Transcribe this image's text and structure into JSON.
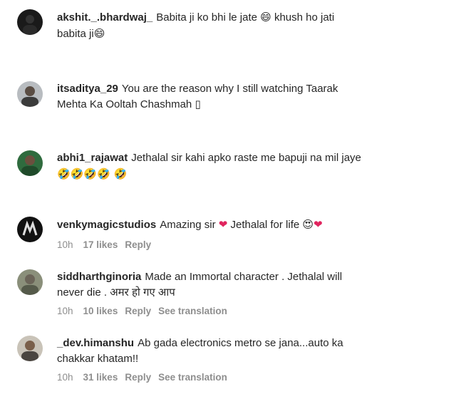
{
  "comments": [
    {
      "username": "akshit._.bhardwaj_",
      "line1": "Babita ji ko bhi le jate ",
      "emoji1": "😄",
      "line1b": " khush ho jati",
      "line2": "babita ji",
      "emoji2": "😄"
    },
    {
      "username": "itsaditya_29",
      "line1": "You are the reason why I still watching Taarak",
      "line2": "Mehta Ka Ooltah Chashmah ▯"
    },
    {
      "username": "abhi1_rajawat",
      "line1": "Jethalal sir kahi apko raste me bapuji na mil jaye",
      "emojis": "🤣🤣🤣🤣 🤣"
    },
    {
      "username": "venkymagicstudios",
      "line1": "Amazing sir ",
      "heart1": "❤",
      "line1b": " Jethalal for life ",
      "emoji_end": "😍",
      "heart2": "❤",
      "time": "10h",
      "likes": "17 likes",
      "reply": "Reply"
    },
    {
      "username": "siddharthginoria",
      "line1": "Made an Immortal character . Jethalal will",
      "line2": "never die . अमर हो गए आप",
      "time": "10h",
      "likes": "10 likes",
      "reply": "Reply",
      "see_translation": "See translation"
    },
    {
      "username": "_dev.himanshu",
      "line1": "Ab gada electronics metro se jana...auto ka",
      "line2": "chakkar khatam!!",
      "time": "10h",
      "likes": "31 likes",
      "reply": "Reply",
      "see_translation": "See translation"
    }
  ]
}
